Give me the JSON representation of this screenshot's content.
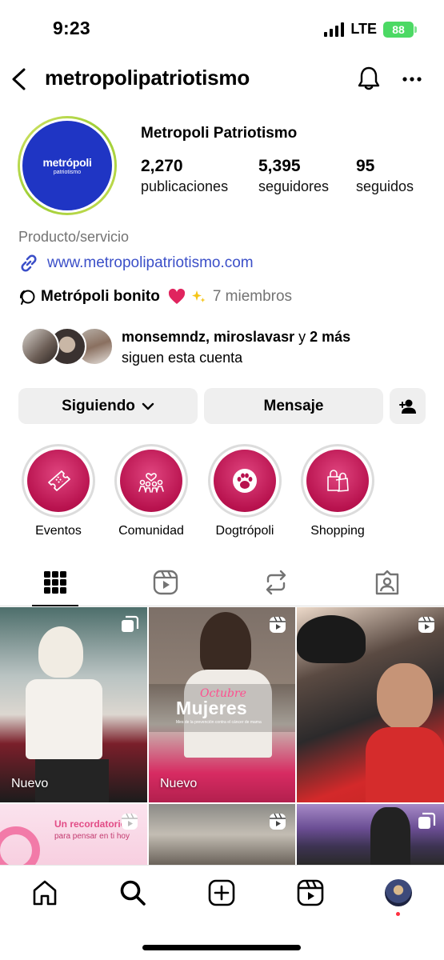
{
  "status_bar": {
    "time": "9:23",
    "network": "LTE",
    "battery": "88"
  },
  "header": {
    "username": "metropolipatriotismo"
  },
  "profile": {
    "avatar_logo": "metrópoli",
    "avatar_sub": "patriotismo",
    "display_name": "Metropoli Patriotismo",
    "stats": [
      {
        "value": "2,270",
        "label": "publicaciones"
      },
      {
        "value": "5,395",
        "label": "seguidores"
      },
      {
        "value": "95",
        "label": "seguidos"
      }
    ],
    "category": "Producto/servicio",
    "website": "www.metropolipatriotismo.com",
    "channel": {
      "name": "Metrópoli bonito",
      "members": "7 miembros"
    },
    "followed_by": {
      "names": "monsemndz, miroslavasr",
      "connector": " y ",
      "more": "2 más",
      "suffix": "siguen esta cuenta"
    }
  },
  "buttons": {
    "following": "Siguiendo",
    "message": "Mensaje"
  },
  "highlights": [
    {
      "label": "Eventos",
      "icon": "ticket-icon"
    },
    {
      "label": "Comunidad",
      "icon": "community-icon"
    },
    {
      "label": "Dogtrópoli",
      "icon": "paw-icon"
    },
    {
      "label": "Shopping",
      "icon": "shopping-bag-icon"
    }
  ],
  "grid": {
    "posts": [
      {
        "label": "Nuevo",
        "badge": "multi-post-icon"
      },
      {
        "label": "Nuevo",
        "badge": "reel-icon",
        "overlay_title": "Mujeres",
        "overlay_script": "Octubre",
        "overlay_sub": "Mes de la prevención contra el cáncer de mama"
      },
      {
        "label": "",
        "badge": "reel-icon"
      },
      {
        "label": "",
        "badge": "reel-icon",
        "overlay_title": "Un recordatorio",
        "overlay_sub": "para pensar en ti hoy"
      },
      {
        "label": "",
        "badge": "reel-icon"
      },
      {
        "label": "",
        "badge": "multi-post-icon"
      }
    ]
  },
  "colors": {
    "link": "#3b4fc8",
    "accent": "#b8124e",
    "avatar_bg": "#1f35c4",
    "battery": "#4cd964"
  }
}
